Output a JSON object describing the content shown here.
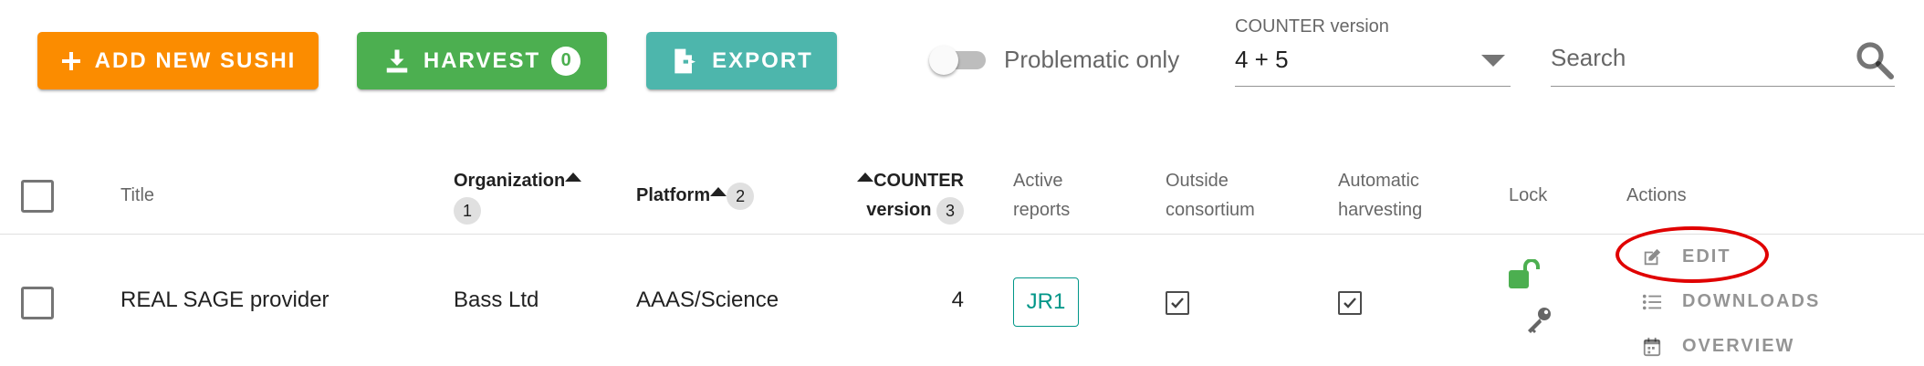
{
  "toolbar": {
    "add_label": "ADD NEW SUSHI",
    "harvest_label": "HARVEST",
    "harvest_count": "0",
    "export_label": "EXPORT",
    "problematic_label": "Problematic only",
    "problematic_on": false,
    "counter_version_label": "COUNTER version",
    "counter_version_value": "4 + 5",
    "search_placeholder": "Search"
  },
  "table": {
    "headers": {
      "title": "Title",
      "organization": "Organization",
      "organization_sort": "1",
      "platform": "Platform",
      "platform_sort": "2",
      "counter_line1": "COUNTER",
      "counter_line2": "version",
      "counter_sort": "3",
      "active_line1": "Active",
      "active_line2": "reports",
      "outside_line1": "Outside",
      "outside_line2": "consortium",
      "automatic_line1": "Automatic",
      "automatic_line2": "harvesting",
      "lock": "Lock",
      "actions": "Actions"
    },
    "rows": [
      {
        "title": "REAL SAGE provider",
        "organization": "Bass Ltd",
        "platform": "AAAS/Science",
        "counter_version": "4",
        "active_report": "JR1",
        "outside_consortium": true,
        "automatic_harvesting": true,
        "actions": [
          "EDIT",
          "DOWNLOADS",
          "OVERVIEW"
        ]
      }
    ]
  },
  "colors": {
    "add": "#fb8c00",
    "harvest": "#4caf50",
    "export": "#4db6ac",
    "chip": "#009688",
    "lock": "#4caf50",
    "highlight": "#e00000"
  }
}
